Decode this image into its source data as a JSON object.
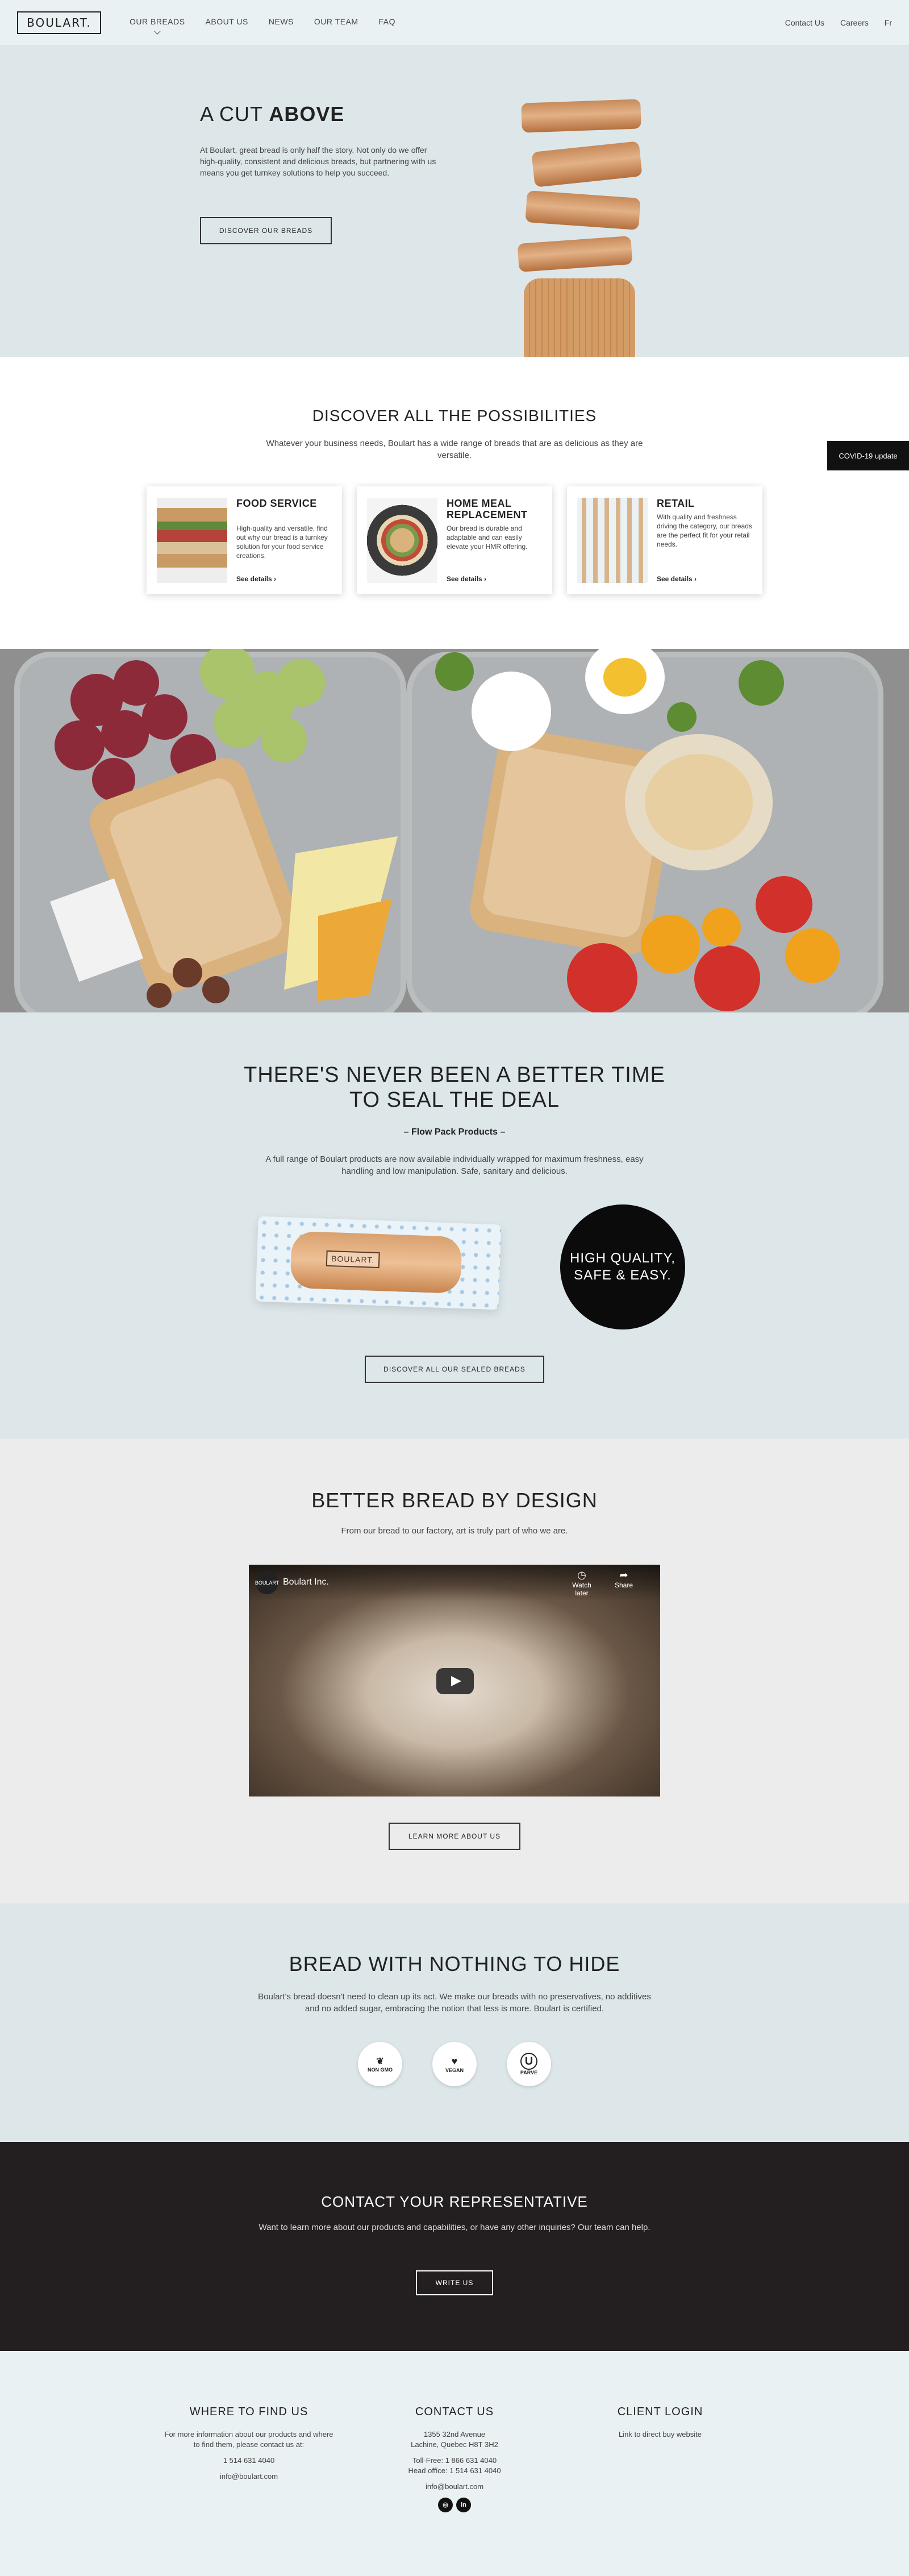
{
  "header": {
    "logo": "BOULART.",
    "nav": [
      "OUR BREADS",
      "ABOUT US",
      "NEWS",
      "OUR TEAM",
      "FAQ"
    ],
    "util": [
      "Contact Us",
      "Careers",
      "Fr"
    ]
  },
  "hero": {
    "title_light": "A CUT ",
    "title_bold": "ABOVE",
    "text": "At Boulart, great bread is only half the story. Not only do we offer high-quality, consistent and delicious breads, but partnering with us means you get turnkey solutions to help you succeed.",
    "button": "DISCOVER OUR BREADS"
  },
  "covid": "COVID-19 update",
  "possibilities": {
    "title_light": "DISCOVER ALL ",
    "title_bold": "THE POSSIBILITIES",
    "subtitle": "Whatever your business needs, Boulart has a wide range of breads that are as delicious as they are versatile.",
    "cards": [
      {
        "title": "FOOD SERVICE",
        "text": "High-quality and versatile, find out why our bread is a turnkey solution for your food service creations.",
        "link": "See details"
      },
      {
        "title": "HOME MEAL REPLACEMENT",
        "text": "Our bread is durable and adaptable and can easily elevate your HMR offering.",
        "link": "See details"
      },
      {
        "title": "RETAIL",
        "text": "With quality and freshness driving the category, our breads are the perfect fit for your retail needs.",
        "link": "See details"
      }
    ]
  },
  "seal": {
    "title_line1": "THERE'S NEVER BEEN A BETTER TIME",
    "title_line2": "TO SEAL THE DEAL",
    "subtitle": "– Flow Pack Products –",
    "text": "A full range of Boulart products are now available individually wrapped for maximum freshness, easy handling and low manipulation. Safe, sanitary and delicious.",
    "pack_label": "BOULART.",
    "circle_line1": "HIGH QUALITY,",
    "circle_line2": "SAFE & EASY.",
    "button": "DISCOVER ALL OUR SEALED BREADS"
  },
  "design": {
    "title": "BETTER BREAD BY DESIGN",
    "subtitle": "From our bread to our factory, art is truly part of who we are.",
    "video_channel": "Boulart Inc.",
    "video_logo": "BOULART",
    "watch_later": "Watch later",
    "share": "Share",
    "button": "LEARN MORE ABOUT US"
  },
  "hide": {
    "title": "BREAD WITH NOTHING TO HIDE",
    "text": "Boulart's bread doesn't need to clean up its act. We make our breads with no preservatives, no additives and no added sugar, embracing the notion that less is more. Boulart is certified.",
    "badges": [
      "NON GMO",
      "VEGAN",
      "PARVE"
    ]
  },
  "contact": {
    "title": "CONTACT YOUR REPRESENTATIVE",
    "text": "Want to learn more about our products and capabilities, or have any other inquiries? Our team can help.",
    "button": "WRITE US"
  },
  "footer": {
    "find": {
      "title": "WHERE TO FIND US",
      "text": "For more information about our products and where to find them, please contact us at:",
      "phone": "1 514 631 4040",
      "email": "info@boulart.com"
    },
    "contact": {
      "title": "CONTACT US",
      "address1": "1355 32nd Avenue",
      "address2": "Lachine, Quebec H8T 3H2",
      "tollfree": "Toll-Free: 1 866 631 4040",
      "head": "Head office: 1 514 631 4040",
      "email": "info@boulart.com"
    },
    "client": {
      "title": "CLIENT LOGIN",
      "text": "Link to direct buy website"
    }
  },
  "colors": {
    "light_blue": "#dde7ea",
    "dark": "#231f20",
    "header": "#e9f1f3"
  }
}
